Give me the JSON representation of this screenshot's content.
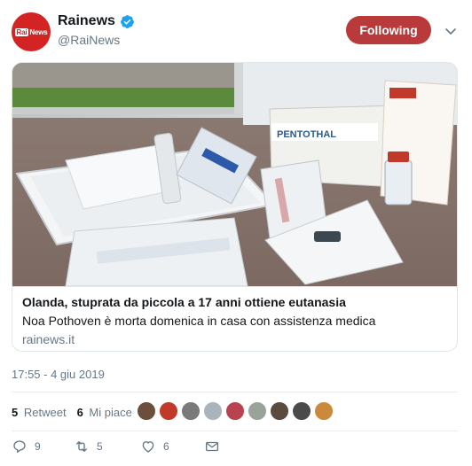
{
  "tweet": {
    "display_name": "Rainews",
    "handle": "@RaiNews",
    "follow_label": "Following",
    "avatar_logo_left": "Rai",
    "avatar_logo_right": "News",
    "accent_color": "#b83a3a",
    "verified_color": "#1da1f2"
  },
  "card": {
    "title": "Olanda, stuprata da piccola a 17 anni ottiene eutanasia",
    "description": "Noa Pothoven è morta domenica in casa con assistenza medica",
    "domain": "rainews.it",
    "image_label": "PENTOTHAL"
  },
  "meta": {
    "timestamp": "17:55 - 4 giu 2019"
  },
  "stats": {
    "retweets_count": "5",
    "retweets_label": "Retweet",
    "likes_count": "6",
    "likes_label": "Mi piace"
  },
  "likers": [
    {
      "color": "#6b4f3a"
    },
    {
      "color": "#c0392b"
    },
    {
      "color": "#7a7a7a"
    },
    {
      "color": "#a9b4bd"
    },
    {
      "color": "#b8434e"
    },
    {
      "color": "#9aa39a"
    },
    {
      "color": "#5b4a3e"
    },
    {
      "color": "#4a4a4a"
    },
    {
      "color": "#c98a3c"
    }
  ],
  "actions": {
    "replies": "9",
    "retweets": "5",
    "likes": "6"
  }
}
